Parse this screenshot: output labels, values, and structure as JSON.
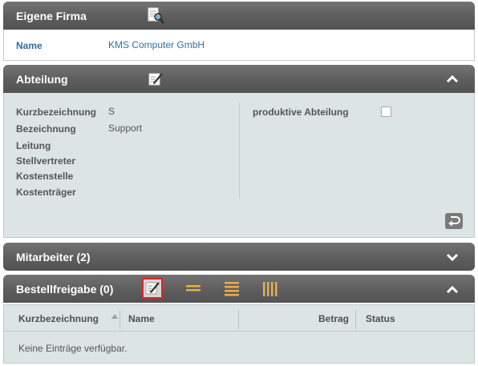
{
  "firma": {
    "title": "Eigene Firma",
    "name_label": "Name",
    "name_value": "KMS Computer GmbH",
    "header_icon": "search-document-icon"
  },
  "abteilung": {
    "title": "Abteilung",
    "header_icon": "edit-icon",
    "toggle_icon": "chevron-up-icon",
    "fields": [
      {
        "label": "Kurzbezeichnung",
        "value": "S"
      },
      {
        "label": "Bezeichnung",
        "value": "Support"
      },
      {
        "label": "Leitung",
        "value": ""
      },
      {
        "label": "Stellvertreter",
        "value": ""
      },
      {
        "label": "Kostenstelle",
        "value": ""
      },
      {
        "label": "Kostenträger",
        "value": ""
      }
    ],
    "checkbox_label": "produktive Abteilung",
    "checkbox_checked": false,
    "return_icon": "return-icon"
  },
  "mitarbeiter": {
    "title": "Mitarbeiter (2)",
    "toggle_icon": "chevron-down-icon"
  },
  "bestellfreigabe": {
    "title": "Bestellfreigabe (0)",
    "toggle_icon": "chevron-up-icon",
    "toolbar_icons": [
      "edit-icon",
      "two-lines-icon",
      "four-lines-icon",
      "columns-icon"
    ],
    "columns": [
      "Kurzbezeichnung",
      "Name",
      "Betrag",
      "Status"
    ],
    "empty_text": "Keine Einträge verfügbar."
  },
  "colors": {
    "header_bg": "#5d5d5d",
    "panel_bg": "#dde4e4",
    "link": "#2e6fa3",
    "icon_orange": "#e3b04b",
    "highlight_red": "#d9262b"
  }
}
